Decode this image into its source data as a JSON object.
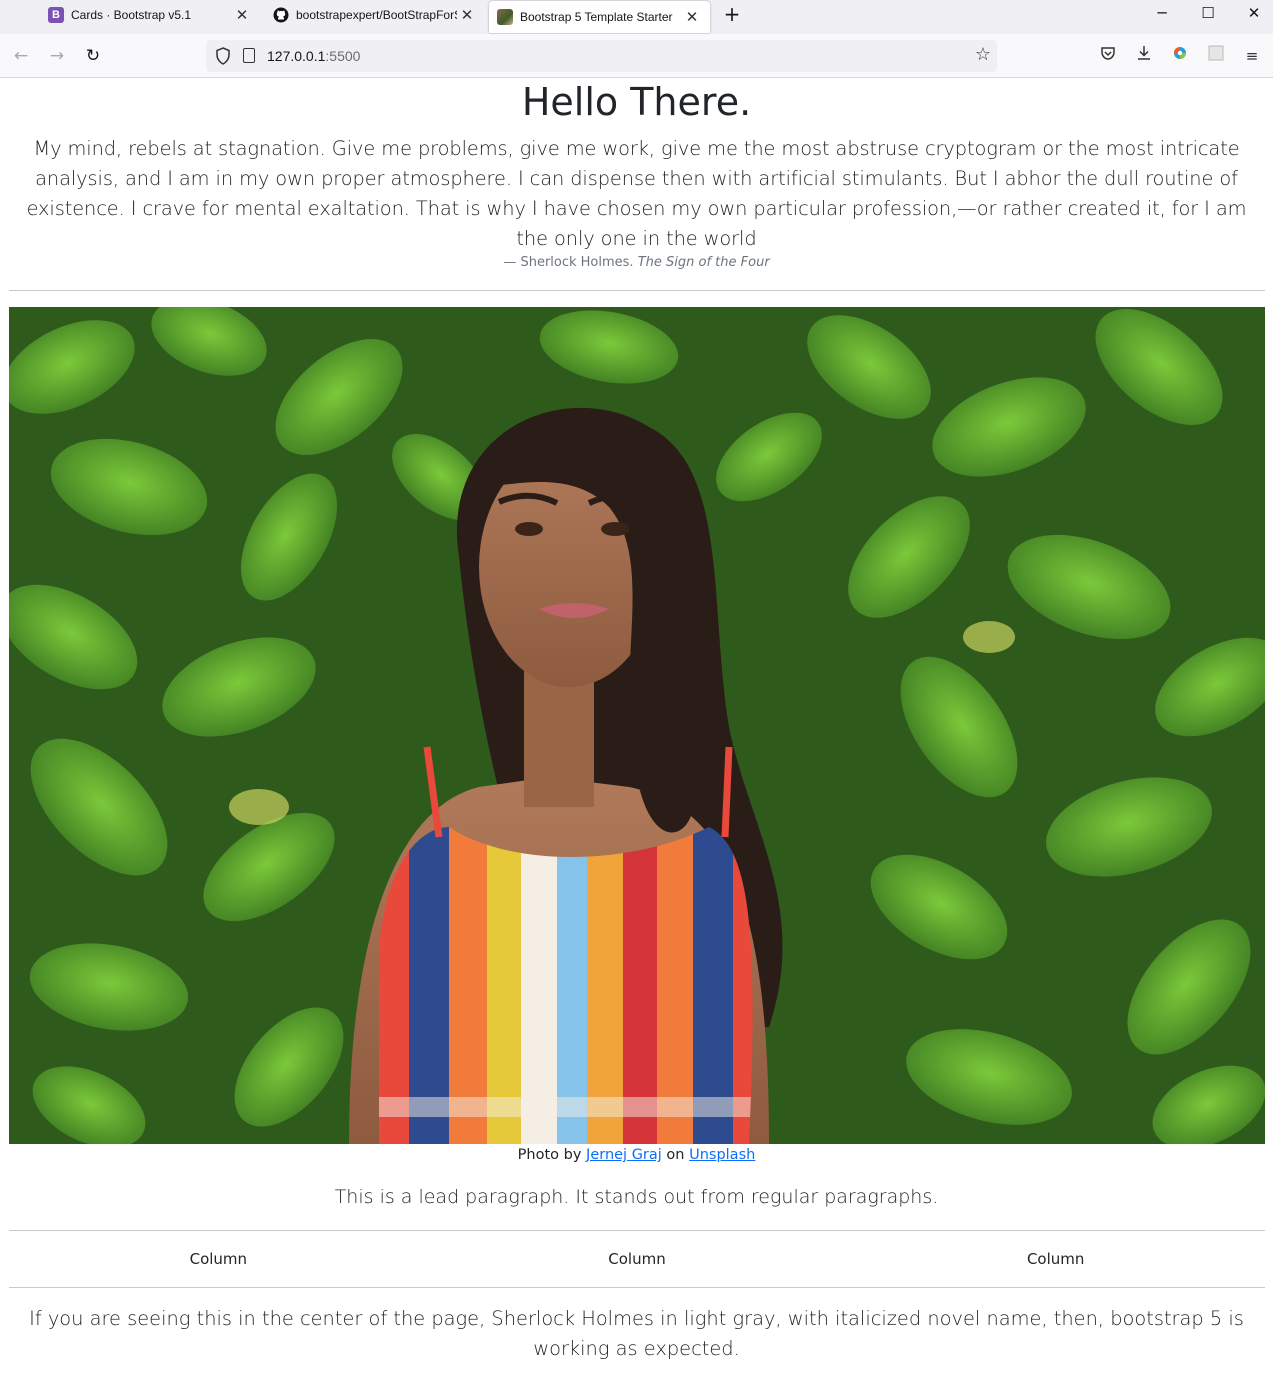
{
  "browser": {
    "tabs": [
      {
        "title": "Cards · Bootstrap v5.1",
        "favicon": "bootstrap-icon",
        "favicon_text": "B",
        "active": false
      },
      {
        "title": "bootstrapexpert/BootStrapForSt",
        "favicon": "github-icon",
        "active": false
      },
      {
        "title": "Bootstrap 5 Template Starter",
        "favicon": "page-thumbnail-icon",
        "active": true
      }
    ],
    "url_host": "127.0.0.1",
    "url_port": ":5500"
  },
  "page": {
    "title": "Hello There.",
    "quote": "My mind, rebels at stagnation. Give me problems, give me work, give me the most abstruse cryptogram or the most intricate analysis, and I am in my own proper atmosphere. I can dispense then with artificial stimulants. But I abhor the dull routine of existence. I crave for mental exaltation. That is why I have chosen my own particular profession,—or rather created it, for I am the only one in the world",
    "cite_dash": "—",
    "cite_author": "Sherlock Holmes.",
    "cite_work": "The Sign of the Four",
    "caption_prefix": "Photo by",
    "caption_author": "Jernej Graj",
    "caption_mid": "on",
    "caption_site": "Unsplash",
    "lead": "This is a lead paragraph. It stands out from regular paragraphs.",
    "columns": [
      "Column",
      "Column",
      "Column"
    ],
    "footer": "If you are seeing this in the center of the page, Sherlock Holmes in light gray, with italicized novel name, then, bootstrap 5 is working as expected."
  },
  "colors": {
    "link": "#0d6efd",
    "muted": "#6c757d",
    "text": "#212529",
    "bootstrap_purple": "#7952b3"
  }
}
